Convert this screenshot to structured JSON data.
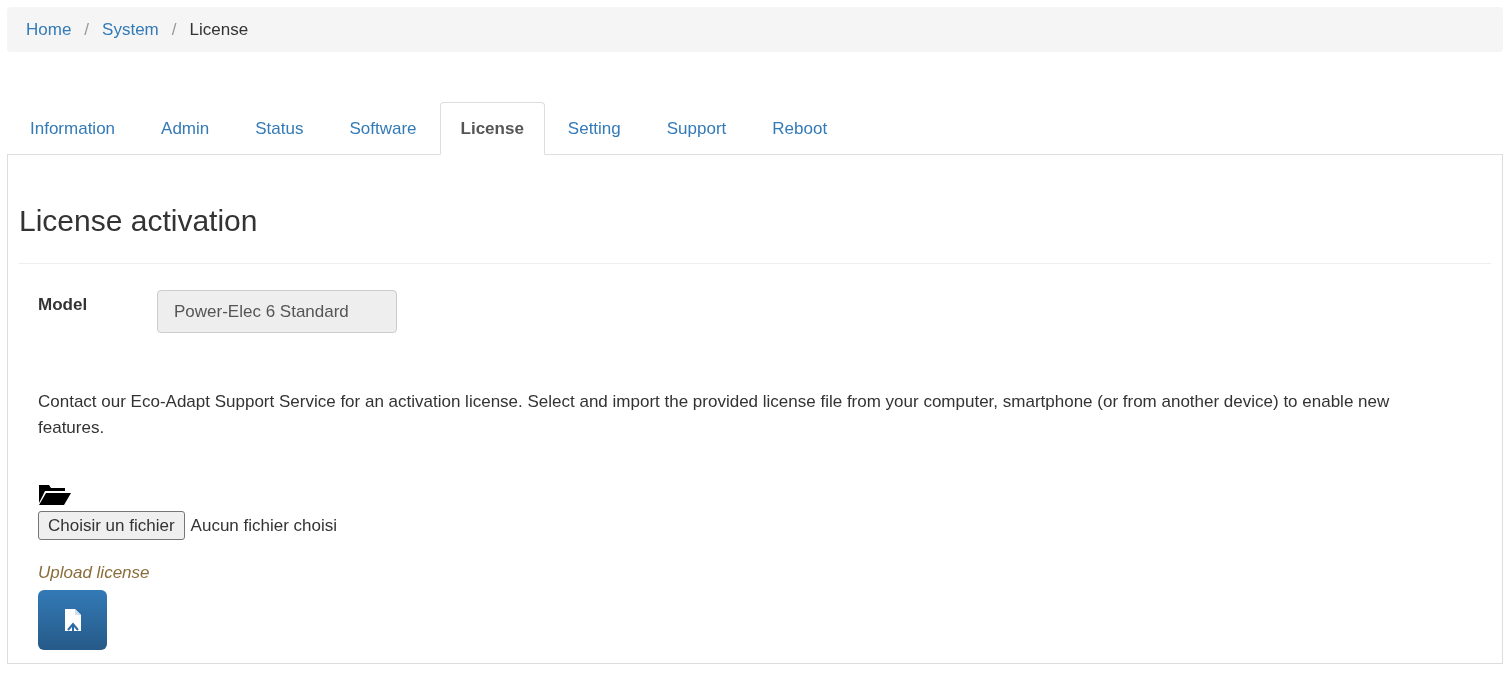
{
  "breadcrumb": [
    {
      "label": "Home",
      "link": true
    },
    {
      "label": "System",
      "link": true
    },
    {
      "label": "License",
      "link": false
    }
  ],
  "separator": "/",
  "tabs": [
    {
      "label": "Information",
      "selected": false
    },
    {
      "label": "Admin",
      "selected": false
    },
    {
      "label": "Status",
      "selected": false
    },
    {
      "label": "Software",
      "selected": false
    },
    {
      "label": "License",
      "selected": true
    },
    {
      "label": "Setting",
      "selected": false
    },
    {
      "label": "Support",
      "selected": false
    },
    {
      "label": "Reboot",
      "selected": false
    }
  ],
  "heading": "License activation",
  "model": {
    "label": "Model",
    "value": "Power-Elec 6 Standard",
    "disabled": true
  },
  "description": "Contact our Eco-Adapt Support Service for an activation license. Select and import the provided license file from your computer, smartphone (or from another device) to enable new features.",
  "file_input": {
    "button": "Choisir un fichier",
    "status": "Aucun fichier choisi"
  },
  "upload": {
    "label": "Upload license"
  }
}
